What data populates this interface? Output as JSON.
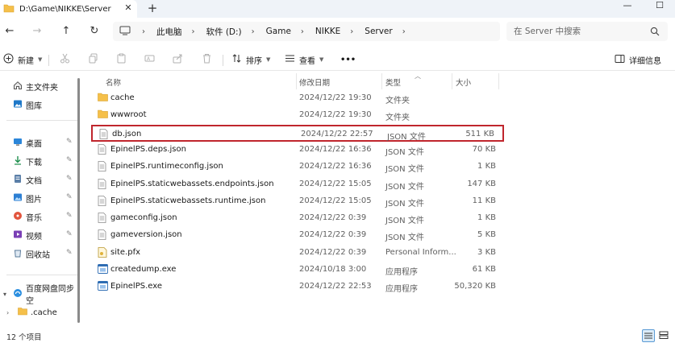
{
  "window": {
    "tab_title": "D:\\Game\\NIKKE\\Server",
    "close_tab": "✕",
    "new_tab": "+",
    "minimize": "—",
    "maximize": "☐"
  },
  "nav": {
    "back": "←",
    "forward": "→",
    "up": "↑",
    "refresh": "↻",
    "breadcrumbs": [
      "此电脑",
      "软件 (D:)",
      "Game",
      "NIKKE",
      "Server"
    ],
    "search_placeholder": "在 Server 中搜索"
  },
  "toolbar": {
    "new_label": "新建",
    "sort_label": "排序",
    "view_label": "查看",
    "more_label": "•••",
    "details_label": "详细信息"
  },
  "sidebar": {
    "items": [
      {
        "label": "主文件夹",
        "icon": "home-icon"
      },
      {
        "label": "图库",
        "icon": "gallery-icon"
      },
      {
        "label": "桌面",
        "icon": "desktop-icon",
        "pinned": true
      },
      {
        "label": "下载",
        "icon": "download-icon",
        "pinned": true
      },
      {
        "label": "文档",
        "icon": "documents-icon",
        "pinned": true
      },
      {
        "label": "图片",
        "icon": "pictures-icon",
        "pinned": true
      },
      {
        "label": "音乐",
        "icon": "music-icon",
        "pinned": true
      },
      {
        "label": "视频",
        "icon": "videos-icon",
        "pinned": true
      },
      {
        "label": "回收站",
        "icon": "recycle-bin-icon",
        "pinned": true
      },
      {
        "label": "百度网盘同步空",
        "icon": "cloud-sync-icon"
      },
      {
        "label": ".cache",
        "icon": "folder-icon"
      }
    ],
    "pin_glyph": "📌"
  },
  "filelist": {
    "headers": {
      "name": "名称",
      "date": "修改日期",
      "type": "类型",
      "size": "大小"
    },
    "rows": [
      {
        "name": "cache",
        "date": "2024/12/22 19:30",
        "type": "文件夹",
        "size": "",
        "icon": "folder-icon"
      },
      {
        "name": "wwwroot",
        "date": "2024/12/22 19:30",
        "type": "文件夹",
        "size": "",
        "icon": "folder-icon"
      },
      {
        "name": "db.json",
        "date": "2024/12/22 22:57",
        "type": "JSON 文件",
        "size": "511 KB",
        "icon": "json-file-icon",
        "selected": true
      },
      {
        "name": "EpinelPS.deps.json",
        "date": "2024/12/22 16:36",
        "type": "JSON 文件",
        "size": "70 KB",
        "icon": "json-file-icon"
      },
      {
        "name": "EpinelPS.runtimeconfig.json",
        "date": "2024/12/22 16:36",
        "type": "JSON 文件",
        "size": "1 KB",
        "icon": "json-file-icon"
      },
      {
        "name": "EpinelPS.staticwebassets.endpoints.json",
        "date": "2024/12/22 15:05",
        "type": "JSON 文件",
        "size": "147 KB",
        "icon": "json-file-icon"
      },
      {
        "name": "EpinelPS.staticwebassets.runtime.json",
        "date": "2024/12/22 15:05",
        "type": "JSON 文件",
        "size": "11 KB",
        "icon": "json-file-icon"
      },
      {
        "name": "gameconfig.json",
        "date": "2024/12/22 0:39",
        "type": "JSON 文件",
        "size": "1 KB",
        "icon": "json-file-icon"
      },
      {
        "name": "gameversion.json",
        "date": "2024/12/22 0:39",
        "type": "JSON 文件",
        "size": "5 KB",
        "icon": "json-file-icon"
      },
      {
        "name": "site.pfx",
        "date": "2024/12/22 0:39",
        "type": "Personal Inform...",
        "size": "3 KB",
        "icon": "certificate-file-icon"
      },
      {
        "name": "createdump.exe",
        "date": "2024/10/18 3:00",
        "type": "应用程序",
        "size": "61 KB",
        "icon": "exe-file-icon"
      },
      {
        "name": "EpinelPS.exe",
        "date": "2024/12/22 22:53",
        "type": "应用程序",
        "size": "50,320 KB",
        "icon": "exe-file-icon"
      }
    ]
  },
  "status": {
    "item_count": "12 个项目"
  },
  "colors": {
    "accent": "#0067c0",
    "folder": "#f5c04a",
    "selection_border": "#c0262d"
  }
}
